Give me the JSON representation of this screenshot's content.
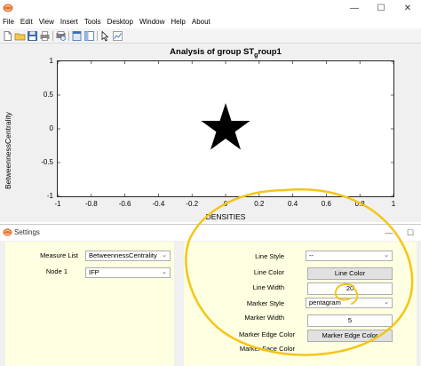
{
  "menubar": {
    "items": [
      "File",
      "Edit",
      "View",
      "Insert",
      "Tools",
      "Desktop",
      "Window",
      "Help",
      "About"
    ]
  },
  "window_controls": {
    "minimize": "—",
    "maximize": "☐",
    "close": "✕"
  },
  "toolbar": {
    "icons": [
      "new-file-icon",
      "open-folder-icon",
      "save-icon",
      "print-icon",
      "print-preview-icon",
      "dock-icon",
      "figure-panel-icon",
      "pointer-icon",
      "data-cursor-icon"
    ]
  },
  "chart_data": {
    "type": "scatter",
    "title": "Analysis of group ST_group1",
    "title_parts": {
      "main": "Analysis of group ST",
      "sub": "g",
      "rest": "roup1"
    },
    "xlabel": "DENSITIES",
    "ylabel": "BetweennessCentrality",
    "xlim": [
      -1,
      1
    ],
    "ylim": [
      -1,
      1
    ],
    "xticks": [
      "-1",
      "-0.8",
      "-0.6",
      "-0.4",
      "-0.2",
      "0",
      "0.2",
      "0.4",
      "0.6",
      "0.8",
      "1"
    ],
    "yticks": [
      "1",
      "0.5",
      "0",
      "-0.5",
      "-1"
    ],
    "grid": false,
    "series": [
      {
        "x": [
          0
        ],
        "y": [
          0
        ],
        "marker": "pentagram",
        "color": "#000000"
      }
    ]
  },
  "settings": {
    "title": "Settings",
    "controls": {
      "minimize": "—",
      "maximize": "☐"
    },
    "left": {
      "measure_list_label": "Measure List",
      "measure_list_value": "BetweennessCentrality",
      "node1_label": "Node 1",
      "node1_value": "IFP"
    },
    "right": {
      "line_style_label": "Line Style",
      "line_style_value": "--",
      "line_color_label": "Line Color",
      "line_color_button": "Line Color",
      "line_width_label": "Line Width",
      "line_width_value": "20",
      "marker_style_label": "Marker Style",
      "marker_style_value": "pentagram",
      "marker_width_label": "Marker Width",
      "marker_width_value": "5",
      "marker_edge_color_label": "Marker Edge Color",
      "marker_edge_color_button": "Marker Edge Color",
      "marker_face_color_label": "Marker Face Color"
    }
  },
  "colors": {
    "panel_bg": "#ffffe1",
    "annotation": "#f5c518",
    "app_icon": "#e8742c"
  }
}
